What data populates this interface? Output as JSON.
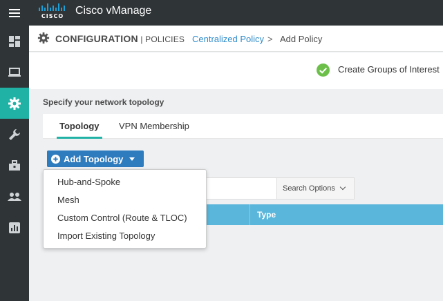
{
  "app": {
    "title": "Cisco vManage",
    "logo_text": "CISCO"
  },
  "header": {
    "section": "CONFIGURATION",
    "section_sep": " | ",
    "subsection": "POLICIES",
    "breadcrumb_link": "Centralized Policy",
    "breadcrumb_sep": ">",
    "breadcrumb_current": "Add Policy"
  },
  "steps": {
    "current_label": "Create Groups of Interest"
  },
  "page": {
    "spec_label": "Specify your network topology"
  },
  "tabs": [
    {
      "label": "Topology",
      "active": true
    },
    {
      "label": "VPN Membership",
      "active": false
    }
  ],
  "add_button": {
    "label": "Add Topology"
  },
  "dropdown": {
    "items": [
      "Hub-and-Spoke",
      "Mesh",
      "Custom Control (Route & TLOC)",
      "Import Existing Topology"
    ]
  },
  "search": {
    "options_label": "Search Options"
  },
  "table": {
    "columns": [
      "Type"
    ]
  },
  "colors": {
    "accent": "#21b2a6",
    "primary_button": "#2e7bbd",
    "table_header": "#5ab6db",
    "sidebar": "#2f3437"
  },
  "sidebar": {
    "items": [
      {
        "icon": "dashboard-icon",
        "active": false
      },
      {
        "icon": "monitor-icon",
        "active": false
      },
      {
        "icon": "gear-icon",
        "active": true
      },
      {
        "icon": "wrench-icon",
        "active": false
      },
      {
        "icon": "toolbox-icon",
        "active": false
      },
      {
        "icon": "users-icon",
        "active": false
      },
      {
        "icon": "analytics-icon",
        "active": false
      }
    ]
  }
}
